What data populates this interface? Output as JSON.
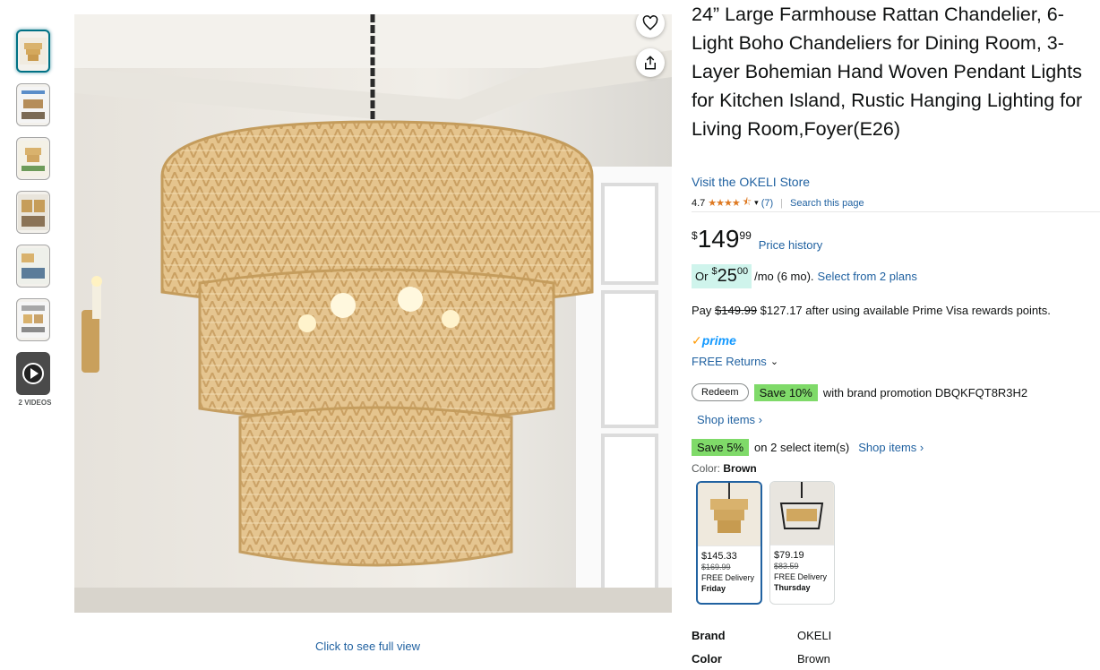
{
  "product": {
    "title": "24” Large Farmhouse Rattan Chandelier, 6-Light Boho Chandeliers for Dining Room, 3-Layer Bohemian Hand Woven Pendant Lights for Kitchen Island, Rustic Hanging Lighting for Living Room,Foyer(E26)",
    "store_link": "Visit the OKELI Store",
    "rating_value": "4.7",
    "rating_count": "(7)",
    "search_page": "Search this page"
  },
  "gallery": {
    "thumb_count": 7,
    "videos_label": "2 VIDEOS",
    "full_view": "Click to see full view"
  },
  "price": {
    "currency": "$",
    "whole": "149",
    "fraction": "99",
    "history_link": "Price history"
  },
  "installment": {
    "or_label": "Or",
    "currency": "$",
    "whole": "25",
    "fraction": "00",
    "term": "/mo (6 mo).",
    "plans_link": "Select from 2 plans"
  },
  "prime_visa": {
    "prefix": "Pay",
    "old_price": "$149.99",
    "new_text": "$127.17 after using available Prime Visa rewards points."
  },
  "prime_label": "prime",
  "returns_label": "FREE Returns",
  "promo": {
    "redeem": "Redeem",
    "save_badge": "Save 10%",
    "text": "with brand promotion DBQKFQT8R3H2",
    "shop_items": "Shop items ›"
  },
  "promo2": {
    "save_badge": "Save 5%",
    "text": "on 2 select item(s)",
    "shop_items": "Shop items ›"
  },
  "color": {
    "label": "Color:",
    "value": "Brown"
  },
  "swatches": [
    {
      "price": "$145.33",
      "old_price": "$169.99",
      "delivery": "FREE Delivery",
      "day": "Friday"
    },
    {
      "price": "$79.19",
      "old_price": "$83.59",
      "delivery": "FREE Delivery",
      "day": "Thursday"
    }
  ],
  "specs": [
    {
      "key": "Brand",
      "value": "OKELI"
    },
    {
      "key": "Color",
      "value": "Brown"
    }
  ],
  "colors": {
    "link": "#2162A1",
    "save_green": "#7FDA69",
    "installment_bg": "#CFF4EC",
    "prime_blue": "#1399FF",
    "star": "#DE7921"
  }
}
